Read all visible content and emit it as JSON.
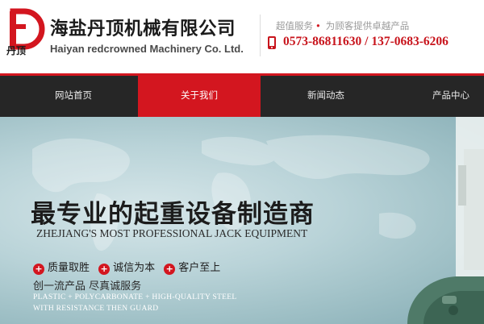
{
  "header": {
    "logo_text": "丹顶",
    "company_cn": "海盐丹顶机械有限公司",
    "company_en": "Haiyan redcrowned Machinery Co. Ltd.",
    "tagline_left": "超值服务",
    "tagline_dot": "•",
    "tagline_right": "为顾客提供卓越产品",
    "phone": "0573-86811630 / 137-0683-6206"
  },
  "nav": {
    "items": [
      {
        "label": "网站首页"
      },
      {
        "label": "关于我们"
      },
      {
        "label": "新闻动态"
      },
      {
        "label": "产品中心"
      }
    ],
    "active_index": 1
  },
  "banner": {
    "headline": "最专业的起重设备制造商",
    "subline": "ZHEJIANG'S MOST PROFESSIONAL JACK EQUIPMENT",
    "features": [
      {
        "plus": "+",
        "label": "质量取胜"
      },
      {
        "plus": "+",
        "label": "诚信为本"
      },
      {
        "plus": "+",
        "label": "客户至上"
      }
    ],
    "slogan": "创一流产品  尽真诚服务",
    "desc_line1": "PLASTIC + POLYCARBONATE + HIGH-QUALITY STEEL",
    "desc_line2": "WITH RESISTANCE THEN GUARD"
  },
  "colors": {
    "brand_red": "#d3161f",
    "nav_bg": "#262626",
    "banner_bg": "#b9d3d8"
  },
  "icons": [
    "logo-d-mark",
    "phone-icon",
    "plus-icon"
  ]
}
